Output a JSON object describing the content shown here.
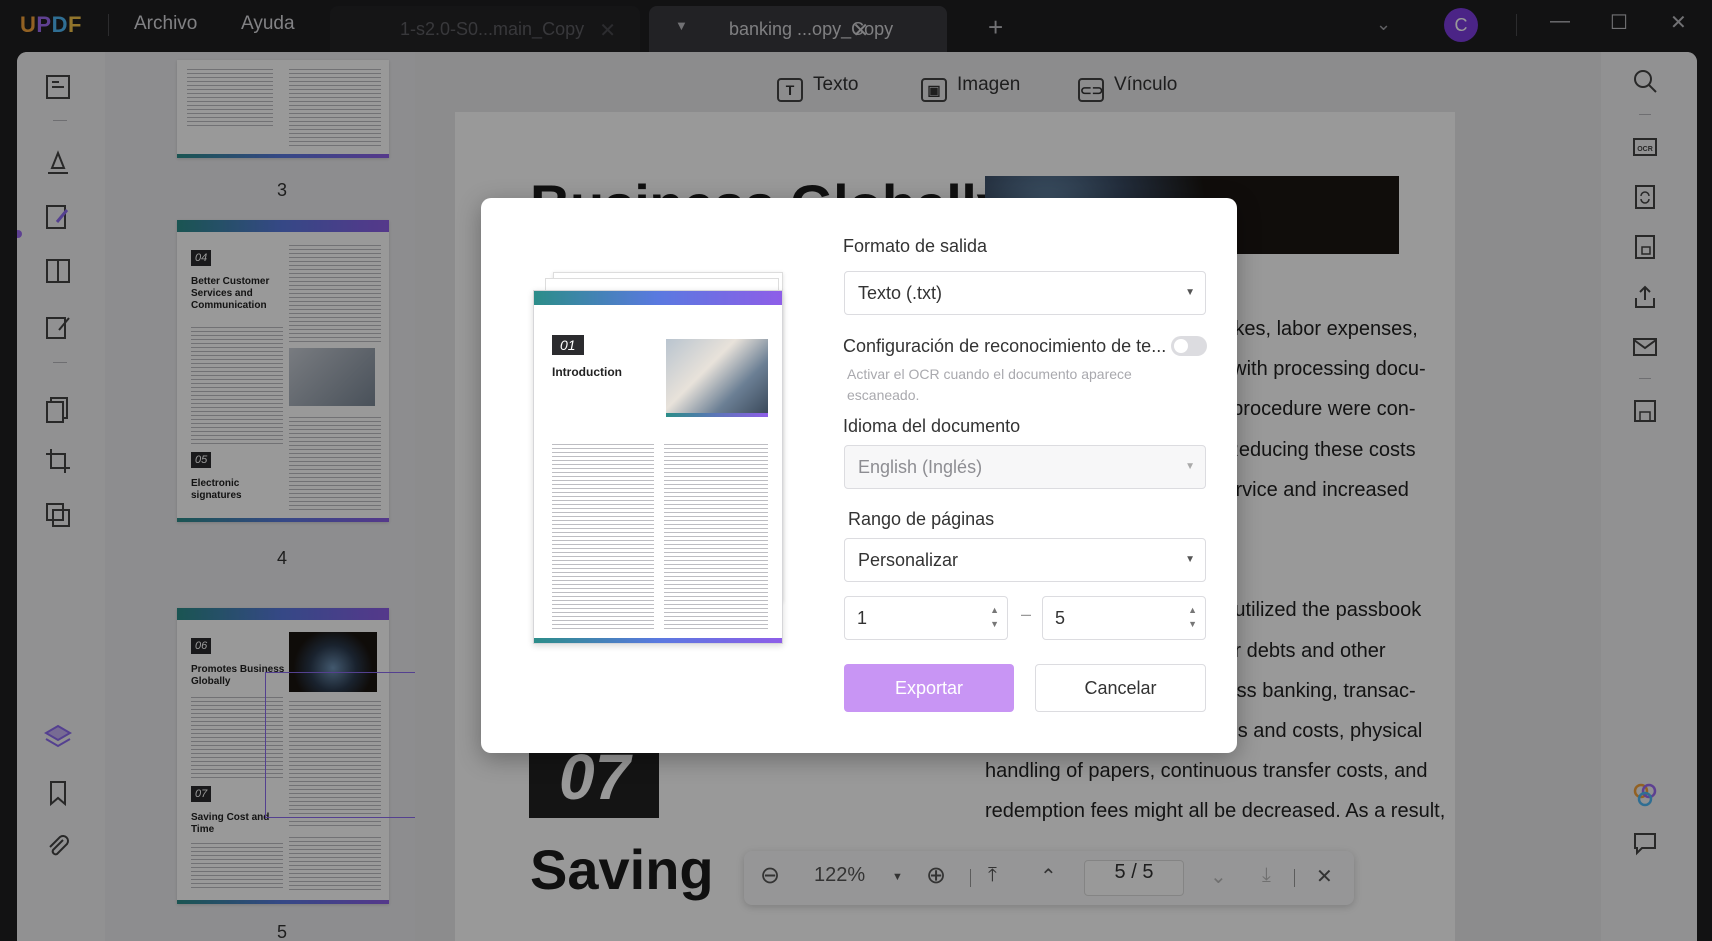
{
  "titlebar": {
    "logo": "UPDF",
    "menu": [
      "Archivo",
      "Ayuda"
    ],
    "tabs": [
      {
        "label": "1-s2.0-S0...main_Copy",
        "active": false
      },
      {
        "label": "banking ...opy_Copy",
        "active": true
      }
    ],
    "avatar_initial": "C"
  },
  "edit_toolbar": {
    "text": "Texto",
    "image": "Imagen",
    "link": "Vínculo"
  },
  "thumbnails": {
    "page3": {
      "number": "3"
    },
    "page4": {
      "number": "4",
      "sec1_num": "04",
      "sec1_title": "Better Customer Services and Communication",
      "sec2_num": "05",
      "sec2_title": "Electronic signatures"
    },
    "page5": {
      "number": "5",
      "sec1_num": "06",
      "sec1_title": "Promotes Business Globally",
      "sec2_num": "07",
      "sec2_title": "Saving Cost and Time"
    }
  },
  "document": {
    "title": "Business Globally",
    "title2": "Saving",
    "section_num": "07",
    "body_lines": [
      "uman mistakes, labor expenses,",
      "associated with processing docu-",
      "ease if this procedure were con-",
      "ronic one. Reducing these costs",
      "mproved service and increased",
      "",
      "",
      "eople have utilized the passbook",
      "track of their debts and other",
      "ugh paperless banking, transac-",
      "nting hassles and costs, physical",
      "handling of papers, continuous transfer costs, and",
      "redemption fees might all be decreased. As a result,",
      "",
      "",
      ""
    ]
  },
  "zoom_bar": {
    "zoom": "122%",
    "current_page": "5",
    "separator": "/",
    "total_pages": "5"
  },
  "dialog": {
    "preview": {
      "num": "01",
      "title": "Introduction"
    },
    "format_label": "Formato de salida",
    "format_value": "Texto (.txt)",
    "ocr_label": "Configuración de reconocimiento de te...",
    "ocr_hint": "Activar el OCR cuando el documento aparece escaneado.",
    "language_label": "Idioma del documento",
    "language_value": "English (Inglés)",
    "range_label": "Rango de páginas",
    "range_value": "Personalizar",
    "range_from": "1",
    "range_to": "5",
    "export_button": "Exportar",
    "cancel_button": "Cancelar"
  },
  "colors": {
    "accent": "#c895f4",
    "brand_purple": "#9c6bf2",
    "avatar": "#7d3ce0"
  }
}
